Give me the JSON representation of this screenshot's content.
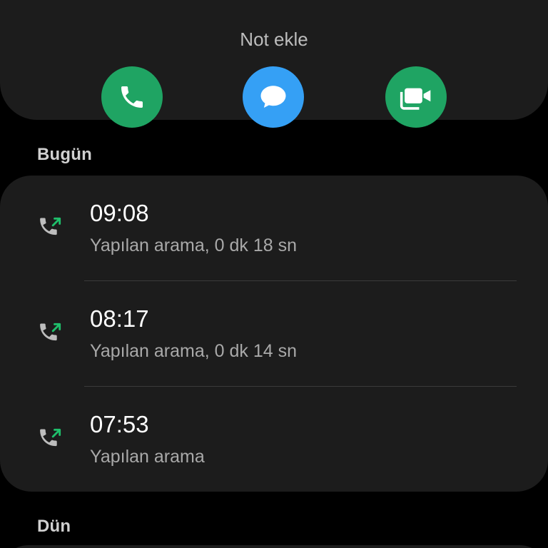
{
  "contact": {
    "partial_name": "Not ekle"
  },
  "actions": {
    "call_color": "#1fa463",
    "message_color": "#35a0f5",
    "video_color": "#1fa463"
  },
  "sections": [
    {
      "label": "Bugün",
      "calls": [
        {
          "time": "09:08",
          "description": "Yapılan arama, 0 dk 18 sn",
          "type_icon": "outgoing-call-icon"
        },
        {
          "time": "08:17",
          "description": "Yapılan arama, 0 dk 14 sn",
          "type_icon": "outgoing-call-icon"
        },
        {
          "time": "07:53",
          "description": "Yapılan arama",
          "type_icon": "outgoing-call-icon"
        }
      ]
    },
    {
      "label": "Dün",
      "calls": []
    }
  ],
  "colors": {
    "background": "#000000",
    "card": "#1c1c1c",
    "outgoing_arrow": "#1fbf6b"
  }
}
